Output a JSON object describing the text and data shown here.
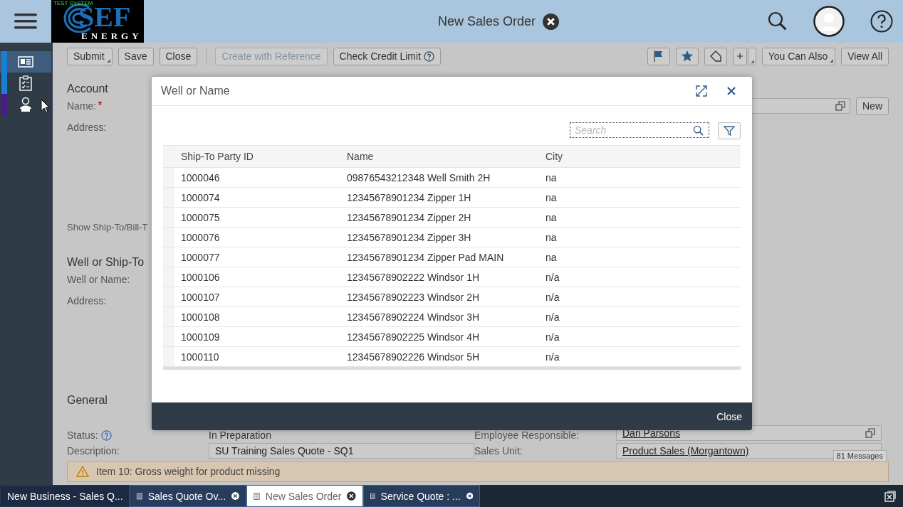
{
  "shell": {
    "title": "New Sales Order",
    "logo": {
      "badge": "TEST SYSTEM",
      "brand": "SEF",
      "sub": "ENERGY"
    }
  },
  "sidebar": {
    "items": [
      {
        "kind": "card",
        "selected": true,
        "color": "#1a7fd1"
      },
      {
        "kind": "checklist",
        "selected": false,
        "color": "#1a7fd1"
      },
      {
        "kind": "person",
        "selected": false,
        "color": "#4b1a8a"
      }
    ]
  },
  "toolbar": {
    "buttons": [
      {
        "label": "Submit",
        "menu": true,
        "help": false,
        "disabled": false
      },
      {
        "label": "Save",
        "menu": false,
        "help": false,
        "disabled": false
      },
      {
        "label": "Close",
        "menu": false,
        "help": false,
        "disabled": false
      },
      {
        "label": "Create with Reference",
        "menu": false,
        "help": false,
        "disabled": true
      },
      {
        "label": "Check Credit Limit",
        "menu": false,
        "help": true,
        "disabled": false
      }
    ],
    "icon_buttons": [
      {
        "kind": "flag"
      },
      {
        "kind": "star"
      },
      {
        "kind": "tag"
      },
      {
        "kind": "new"
      }
    ],
    "menus": [
      {
        "label": "You Can Also",
        "menu": true
      },
      {
        "label": "View All",
        "menu": false
      }
    ]
  },
  "account": {
    "heading": "Account",
    "name_label": "Name:",
    "required_mark": "*",
    "address_label": "Address:",
    "new_button": "New",
    "show_link": "Show Ship-To/Bill-T"
  },
  "well": {
    "heading": "Well or Ship-To",
    "name_label": "Well or Name:",
    "address_label": "Address:"
  },
  "general": {
    "heading": "General",
    "status_label": "Status:",
    "status_value": "In Preparation",
    "employee_label": "Employee Responsible:",
    "employee_value": "Dan Parsons",
    "description_label": "Description:",
    "description_value": "SU Training Sales Quote - SQ1",
    "sales_unit_label": "Sales Unit:",
    "sales_unit_value": "Product Sales (Morgantown)"
  },
  "message": {
    "text": "Item 10: Gross weight for product missing",
    "count": "81 Messages"
  },
  "dialog": {
    "title": "Well or Name",
    "search": {
      "placeholder": "Search"
    },
    "columns": [
      "Ship-To Party ID",
      "Name",
      "City"
    ],
    "rows": [
      [
        "1000046",
        "09876543212348 Well Smith 2H",
        "na"
      ],
      [
        "1000074",
        "12345678901234 Zipper 1H",
        "na"
      ],
      [
        "1000075",
        "12345678901234 Zipper 2H",
        "na"
      ],
      [
        "1000076",
        "12345678901234 Zipper 3H",
        "na"
      ],
      [
        "1000077",
        "12345678901234 Zipper Pad MAIN",
        "na"
      ],
      [
        "1000106",
        "12345678902222 Windsor 1H",
        "n/a"
      ],
      [
        "1000107",
        "12345678902223 Windsor 2H",
        "n/a"
      ],
      [
        "1000108",
        "12345678902224 Windsor 3H",
        "n/a"
      ],
      [
        "1000109",
        "12345678902225 Windsor 4H",
        "n/a"
      ],
      [
        "1000110",
        "12345678902226 Windsor 5H",
        "n/a"
      ]
    ],
    "footer_button": "Close"
  },
  "taskbar": {
    "tabs": [
      {
        "label": "New Business - Sales Q...",
        "selected": false,
        "closable": false
      },
      {
        "label": "Sales Quote Ov...",
        "selected": false,
        "closable": true
      },
      {
        "label": "New Sales Order",
        "selected": true,
        "closable": true
      },
      {
        "label": "Service Quote : ...",
        "selected": false,
        "closable": true
      }
    ]
  }
}
